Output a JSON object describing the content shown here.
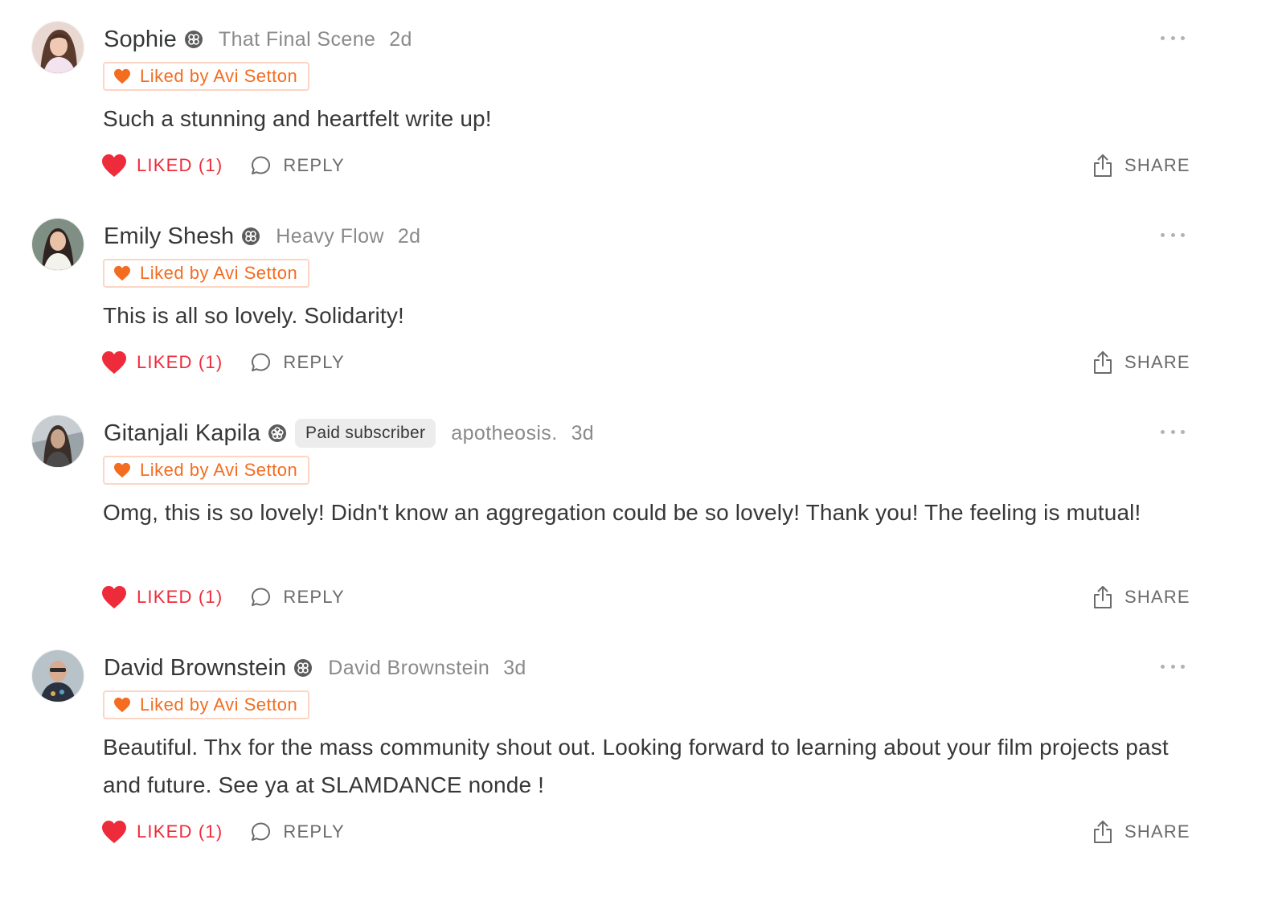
{
  "colors": {
    "accent_orange": "#f36c20",
    "liked_red": "#ee2b3a",
    "text_primary": "#363737",
    "text_muted": "#8a8a8a"
  },
  "comments": [
    {
      "author": "Sophie",
      "badge_icon": "subscriber-badge-icon",
      "publication": "That Final Scene",
      "time": "2d",
      "liked_by": "Liked by Avi Setton",
      "body": "Such a stunning and heartfelt write up!",
      "like_label": "LIKED (1)",
      "reply_label": "REPLY",
      "share_label": "SHARE"
    },
    {
      "author": "Emily Shesh",
      "badge_icon": "subscriber-badge-icon",
      "publication": "Heavy Flow",
      "time": "2d",
      "liked_by": "Liked by Avi Setton",
      "body": "This is all so lovely. Solidarity!",
      "like_label": "LIKED (1)",
      "reply_label": "REPLY",
      "share_label": "SHARE"
    },
    {
      "author": "Gitanjali Kapila",
      "badge_icon": "subscriber-badge-icon",
      "tag": "Paid subscriber",
      "publication": "apotheosis.",
      "time": "3d",
      "liked_by": "Liked by Avi Setton",
      "body": "Omg, this is so lovely! Didn't know an aggregation could be so lovely! Thank you! The feeling is mutual!",
      "like_label": "LIKED (1)",
      "reply_label": "REPLY",
      "share_label": "SHARE"
    },
    {
      "author": "David Brownstein",
      "badge_icon": "subscriber-badge-icon",
      "publication": "David Brownstein",
      "time": "3d",
      "liked_by": "Liked by Avi Setton",
      "body": "Beautiful. Thx for the mass community shout out. Looking forward to learning about your film projects past and future. See ya at SLAMDANCE nonde !",
      "like_label": "LIKED (1)",
      "reply_label": "REPLY",
      "share_label": "SHARE"
    }
  ]
}
